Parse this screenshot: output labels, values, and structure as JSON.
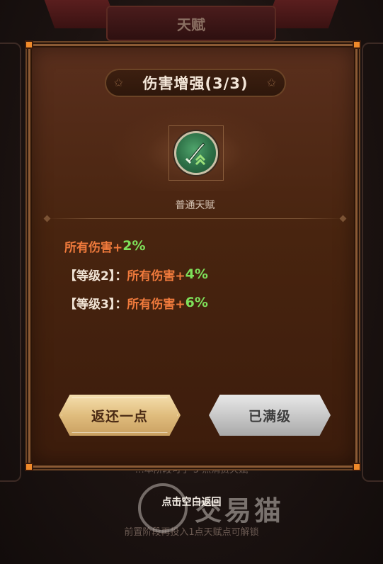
{
  "background": {
    "header_title": "天赋",
    "hint_behind": "…本阶段可于 5 点消费天赋",
    "locked_hint": "前置阶段再投入1点天赋点可解锁"
  },
  "dialog": {
    "title": "伤害增强(3/3)",
    "talent_type": "普通天赋",
    "icon": "sword-upgrade-icon",
    "effects": [
      {
        "prefix": "",
        "label": "所有伤害+",
        "value": "2%"
      },
      {
        "prefix": "【等级2】：",
        "label": "所有伤害+",
        "value": "4%"
      },
      {
        "prefix": "【等级3】：",
        "label": "所有伤害+",
        "value": "6%"
      }
    ],
    "buttons": {
      "refund": "返还一点",
      "maxed": "已满级"
    }
  },
  "tap_to_return": "点击空白返回",
  "watermark": "交易猫",
  "colors": {
    "accent_orange": "#f07a3c",
    "accent_green": "#7ee05a",
    "frame_corner": "#f08a2a"
  }
}
